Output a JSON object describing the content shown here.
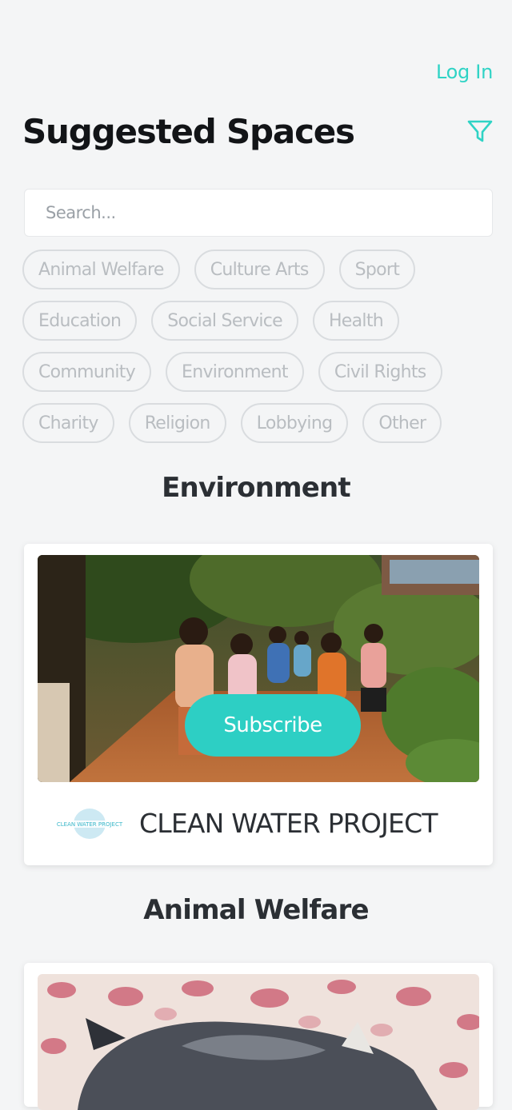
{
  "header": {
    "login_label": "Log In",
    "title": "Suggested Spaces",
    "filter_icon": "filter-icon"
  },
  "search": {
    "placeholder": "Search..."
  },
  "categories": [
    [
      "Animal Welfare",
      "Culture Arts",
      "Sport"
    ],
    [
      "Education",
      "Social Service",
      "Health"
    ],
    [
      "Community",
      "Environment",
      "Civil Rights"
    ],
    [
      "Charity",
      "Religion",
      "Lobbying",
      "Other"
    ]
  ],
  "sections": [
    {
      "title": "Environment",
      "card": {
        "subscribe_label": "Subscribe",
        "org_name": "CLEAN WATER PROJECT",
        "logo_text": "CLEAN WATER PROJECT"
      }
    },
    {
      "title": "Animal Welfare"
    }
  ],
  "colors": {
    "accent": "#2dcfc4",
    "chip_text": "#b9bdc1",
    "background": "#f4f5f6"
  }
}
